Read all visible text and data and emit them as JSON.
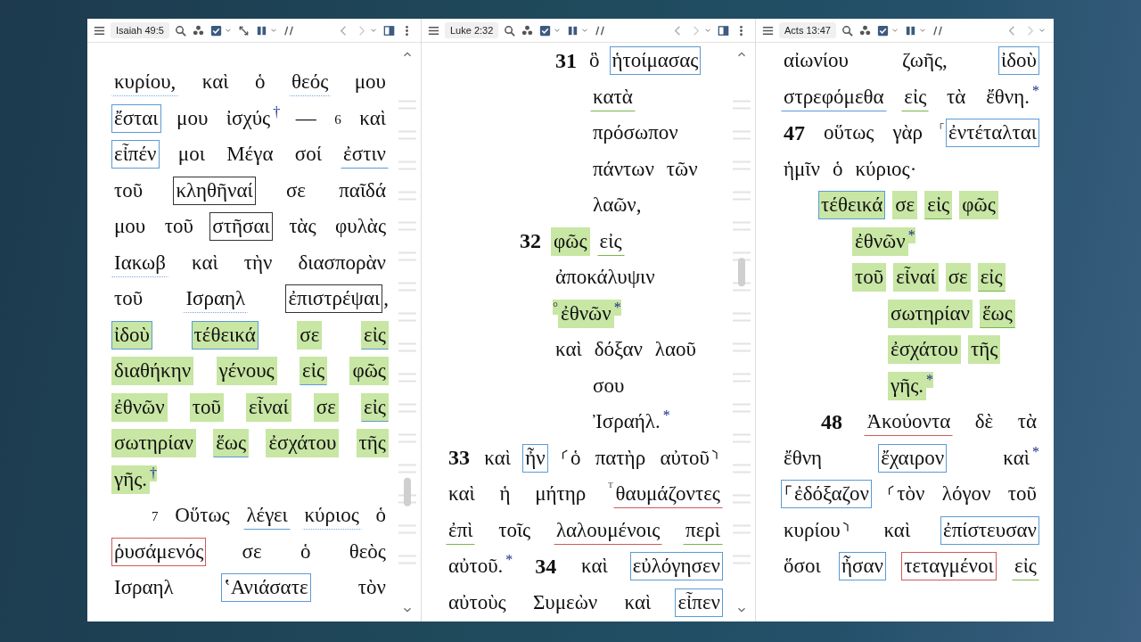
{
  "panes": [
    {
      "toolbar": {
        "reference": "Isaiah 49:5",
        "unlinked": true,
        "pane_menu": true
      },
      "scrollbar": true,
      "lines": [
        {
          "kind": "prose",
          "segs": [
            {
              "t": "κυρίου,",
              "kind": "dotted",
              "highlighted": false
            },
            {
              "t": "καὶ",
              "kind": "plain",
              "highlighted": false
            },
            {
              "t": "ὁ",
              "kind": "plain",
              "highlighted": false
            },
            {
              "t": "θεός",
              "kind": "dotted",
              "highlighted": false
            },
            {
              "t": "μου",
              "kind": "plain",
              "highlighted": false
            }
          ]
        },
        {
          "kind": "prose",
          "segs": [
            {
              "t": "ἔσται",
              "kind": "box",
              "color": "#5b9bd5",
              "highlighted": false
            },
            {
              "t": "μου",
              "kind": "plain",
              "highlighted": false
            },
            {
              "t": "ἰσχύς",
              "kind": "plain",
              "highlighted": false,
              "note": "†"
            },
            {
              "t": "—",
              "kind": "plain",
              "highlighted": false
            },
            {
              "t": "6",
              "kind": "sup",
              "highlighted": false
            },
            {
              "t": "καὶ",
              "kind": "plain",
              "highlighted": false
            }
          ]
        },
        {
          "kind": "prose",
          "segs": [
            {
              "t": "εἶπέν",
              "kind": "box",
              "color": "#5b9bd5",
              "highlighted": false
            },
            {
              "t": "μοι",
              "kind": "plain",
              "highlighted": false
            },
            {
              "t": "Μέγα",
              "kind": "plain",
              "highlighted": false
            },
            {
              "t": "σοί",
              "kind": "plain",
              "highlighted": false
            },
            {
              "t": "ἐστιν",
              "kind": "under",
              "color": "#5b9bd5",
              "highlighted": false
            }
          ]
        },
        {
          "kind": "prose",
          "segs": [
            {
              "t": "τοῦ",
              "kind": "plain",
              "highlighted": false
            },
            {
              "t": "κληθῆναί",
              "kind": "box",
              "color": "#333333",
              "highlighted": false
            },
            {
              "t": "σε",
              "kind": "plain",
              "highlighted": false
            },
            {
              "t": "παῖδά",
              "kind": "plain",
              "highlighted": false
            }
          ]
        },
        {
          "kind": "prose",
          "segs": [
            {
              "t": "μου",
              "kind": "plain",
              "highlighted": false
            },
            {
              "t": "τοῦ",
              "kind": "plain",
              "highlighted": false
            },
            {
              "t": "στῆσαι",
              "kind": "box",
              "color": "#333333",
              "highlighted": false
            },
            {
              "t": "τὰς",
              "kind": "plain",
              "highlighted": false
            },
            {
              "t": "φυλὰς",
              "kind": "plain",
              "highlighted": false
            }
          ]
        },
        {
          "kind": "prose",
          "segs": [
            {
              "t": "Ιακωβ",
              "kind": "dotted",
              "highlighted": false
            },
            {
              "t": "καὶ",
              "kind": "plain",
              "highlighted": false
            },
            {
              "t": "τὴν",
              "kind": "plain",
              "highlighted": false
            },
            {
              "t": "διασπορὰν",
              "kind": "plain",
              "highlighted": false
            }
          ]
        },
        {
          "kind": "prose",
          "segs": [
            {
              "t": "τοῦ",
              "kind": "plain",
              "highlighted": false
            },
            {
              "t": "Ισραηλ",
              "kind": "dotted",
              "highlighted": false
            },
            {
              "t": "ἐπιστρέψαι",
              "kind": "box",
              "color": "#333333",
              "highlighted": false,
              "tail": ","
            }
          ]
        },
        {
          "kind": "prose",
          "segs": [
            {
              "t": "ἰδοὺ",
              "kind": "box",
              "color": "#5b9bd5",
              "highlighted": true
            },
            {
              "t": "τέθεικά",
              "kind": "box",
              "color": "#5b9bd5",
              "highlighted": true
            },
            {
              "t": "σε",
              "kind": "plain",
              "highlighted": true
            },
            {
              "t": "εἰς",
              "kind": "under",
              "color": "#5b9bd5",
              "highlighted": true
            }
          ]
        },
        {
          "kind": "prose",
          "segs": [
            {
              "t": "διαθήκην",
              "kind": "plain",
              "highlighted": true
            },
            {
              "t": "γένους",
              "kind": "plain",
              "highlighted": true
            },
            {
              "t": "εἰς",
              "kind": "under",
              "color": "#5b9bd5",
              "highlighted": true
            },
            {
              "t": "φῶς",
              "kind": "plain",
              "highlighted": true
            }
          ]
        },
        {
          "kind": "prose",
          "segs": [
            {
              "t": "ἐθνῶν",
              "kind": "plain",
              "highlighted": true
            },
            {
              "t": "τοῦ",
              "kind": "plain",
              "highlighted": true
            },
            {
              "t": "εἶναί",
              "kind": "plain",
              "highlighted": true
            },
            {
              "t": "σε",
              "kind": "plain",
              "highlighted": true
            },
            {
              "t": "εἰς",
              "kind": "under",
              "color": "#5b9bd5",
              "highlighted": true
            }
          ]
        },
        {
          "kind": "prose",
          "segs": [
            {
              "t": "σωτηρίαν",
              "kind": "plain",
              "highlighted": true
            },
            {
              "t": "ἕως",
              "kind": "under",
              "color": "#5b9bd5",
              "highlighted": true
            },
            {
              "t": "ἐσχάτου",
              "kind": "plain",
              "highlighted": true
            },
            {
              "t": "τῆς",
              "kind": "plain",
              "highlighted": true
            }
          ]
        },
        {
          "kind": "left",
          "segs": [
            {
              "t": "γῆς.",
              "kind": "plain",
              "highlighted": true,
              "note": "†"
            }
          ]
        },
        {
          "kind": "prose-indent",
          "segs": [
            {
              "t": "7",
              "kind": "sup",
              "highlighted": false
            },
            {
              "t": "Οὕτως",
              "kind": "plain",
              "highlighted": false
            },
            {
              "t": "λέγει",
              "kind": "under",
              "color": "#5b9bd5",
              "highlighted": false
            },
            {
              "t": "κύριος",
              "kind": "dotted",
              "highlighted": false
            },
            {
              "t": "ὁ",
              "kind": "plain",
              "highlighted": false
            }
          ]
        },
        {
          "kind": "prose",
          "segs": [
            {
              "t": "ῥυσάμενός",
              "kind": "box",
              "color": "#d05a5a",
              "highlighted": false
            },
            {
              "t": "σε",
              "kind": "plain",
              "highlighted": false
            },
            {
              "t": "ὁ",
              "kind": "plain",
              "highlighted": false
            },
            {
              "t": "θεὸς",
              "kind": "plain",
              "highlighted": false
            }
          ]
        },
        {
          "kind": "prose",
          "segs": [
            {
              "t": "Ισραηλ",
              "kind": "plain",
              "highlighted": false
            },
            {
              "t": "ʽΑνιάσατε",
              "kind": "box",
              "color": "#5b9bd5",
              "highlighted": false
            },
            {
              "t": "τὸν",
              "kind": "plain",
              "highlighted": false
            }
          ]
        }
      ]
    },
    {
      "toolbar": {
        "reference": "Luke 2:32",
        "unlinked": false,
        "pane_menu": true
      },
      "scrollbar": true,
      "lines": [
        {
          "kind": "indent3",
          "segs": [
            {
              "t": "31",
              "kind": "verse",
              "highlighted": false
            },
            {
              "t": "ὃ",
              "kind": "plain",
              "highlighted": false
            },
            {
              "t": "ἡτοίμασας",
              "kind": "box",
              "color": "#5b9bd5",
              "highlighted": false
            }
          ]
        },
        {
          "kind": "indent4",
          "segs": [
            {
              "t": "κατὰ",
              "kind": "under",
              "color": "#7ab648",
              "highlighted": false
            }
          ]
        },
        {
          "kind": "indent4",
          "segs": [
            {
              "t": "πρόσωπον",
              "kind": "plain",
              "highlighted": false
            }
          ]
        },
        {
          "kind": "indent4",
          "segs": [
            {
              "t": "πάντων",
              "kind": "plain",
              "highlighted": false
            },
            {
              "t": "τῶν",
              "kind": "plain",
              "highlighted": false
            }
          ]
        },
        {
          "kind": "indent4",
          "segs": [
            {
              "t": "λαῶν,",
              "kind": "plain",
              "highlighted": false
            }
          ]
        },
        {
          "kind": "indent2",
          "segs": [
            {
              "t": "32",
              "kind": "verse",
              "highlighted": false
            },
            {
              "t": "φῶς",
              "kind": "plain",
              "highlighted": true
            },
            {
              "t": "εἰς",
              "kind": "under",
              "color": "#7ab648",
              "highlighted": false
            }
          ]
        },
        {
          "kind": "indent3",
          "segs": [
            {
              "t": "ἀποκάλυψιν",
              "kind": "plain",
              "highlighted": false
            }
          ]
        },
        {
          "kind": "indent3",
          "segs": [
            {
              "t": "ἐθνῶν",
              "kind": "plain",
              "highlighted": true,
              "pre": "°",
              "note": "*"
            }
          ]
        },
        {
          "kind": "indent3",
          "segs": [
            {
              "t": "καὶ",
              "kind": "plain",
              "highlighted": false
            },
            {
              "t": "δόξαν",
              "kind": "plain",
              "highlighted": false
            },
            {
              "t": "λαοῦ",
              "kind": "plain",
              "highlighted": false
            }
          ]
        },
        {
          "kind": "indent4",
          "segs": [
            {
              "t": "σου",
              "kind": "plain",
              "highlighted": false
            }
          ]
        },
        {
          "kind": "indent4",
          "segs": [
            {
              "t": "Ἰσραήλ.",
              "kind": "plain",
              "highlighted": false,
              "note": "*"
            }
          ]
        },
        {
          "kind": "prose",
          "segs": [
            {
              "t": "33",
              "kind": "verse",
              "highlighted": false
            },
            {
              "t": "καὶ",
              "kind": "plain",
              "highlighted": false
            },
            {
              "t": "ἦν",
              "kind": "box",
              "color": "#5b9bd5",
              "highlighted": false
            },
            {
              "t": "⸂ὁ",
              "kind": "plain",
              "highlighted": false
            },
            {
              "t": "πατὴρ",
              "kind": "plain",
              "highlighted": false
            },
            {
              "t": "αὐτοῦ⸃",
              "kind": "plain",
              "highlighted": false
            }
          ]
        },
        {
          "kind": "prose",
          "segs": [
            {
              "t": "καὶ",
              "kind": "plain",
              "highlighted": false
            },
            {
              "t": "ἡ",
              "kind": "plain",
              "highlighted": false
            },
            {
              "t": "μήτηρ",
              "kind": "plain",
              "highlighted": false
            },
            {
              "t": "θαυμάζοντες",
              "kind": "under",
              "color": "#d05a5a",
              "highlighted": false,
              "pre": "ᵀ"
            }
          ]
        },
        {
          "kind": "prose",
          "segs": [
            {
              "t": "ἐπὶ",
              "kind": "under",
              "color": "#7ab648",
              "highlighted": false
            },
            {
              "t": "τοῖς",
              "kind": "plain",
              "highlighted": false
            },
            {
              "t": "λαλουμένοις",
              "kind": "under",
              "color": "#d05a5a",
              "highlighted": false
            },
            {
              "t": "περὶ",
              "kind": "under",
              "color": "#7ab648",
              "highlighted": false
            }
          ]
        },
        {
          "kind": "prose",
          "segs": [
            {
              "t": "αὐτοῦ.",
              "kind": "plain",
              "highlighted": false,
              "note": "*"
            },
            {
              "t": "34",
              "kind": "verse",
              "highlighted": false
            },
            {
              "t": "καὶ",
              "kind": "plain",
              "highlighted": false
            },
            {
              "t": "εὐλόγησεν",
              "kind": "box",
              "color": "#5b9bd5",
              "highlighted": false
            }
          ]
        },
        {
          "kind": "prose",
          "segs": [
            {
              "t": "αὐτοὺς",
              "kind": "plain",
              "highlighted": false
            },
            {
              "t": "Συμεὼν",
              "kind": "plain",
              "highlighted": false
            },
            {
              "t": "καὶ",
              "kind": "plain",
              "highlighted": false
            },
            {
              "t": "εἶπεν",
              "kind": "box",
              "color": "#5b9bd5",
              "highlighted": false
            }
          ]
        }
      ]
    },
    {
      "toolbar": {
        "reference": "Acts 13:47",
        "unlinked": false,
        "pane_menu": false
      },
      "scrollbar": false,
      "lines": [
        {
          "kind": "prose",
          "segs": [
            {
              "t": "αἰωνίου",
              "kind": "plain",
              "highlighted": false
            },
            {
              "t": "ζωῆς,",
              "kind": "plain",
              "highlighted": false
            },
            {
              "t": "ἰδοὺ",
              "kind": "box",
              "color": "#5b9bd5",
              "highlighted": false
            }
          ]
        },
        {
          "kind": "prose",
          "segs": [
            {
              "t": "στρεφόμεθα",
              "kind": "under",
              "color": "#5b9bd5",
              "highlighted": false
            },
            {
              "t": "εἰς",
              "kind": "under",
              "color": "#7ab648",
              "highlighted": false
            },
            {
              "t": "τὰ",
              "kind": "plain",
              "highlighted": false
            },
            {
              "t": "ἔθνη.",
              "kind": "plain",
              "highlighted": false,
              "note": "*"
            }
          ]
        },
        {
          "kind": "prose",
          "segs": [
            {
              "t": "47",
              "kind": "verse",
              "highlighted": false
            },
            {
              "t": "οὕτως",
              "kind": "plain",
              "highlighted": false
            },
            {
              "t": "γὰρ",
              "kind": "plain",
              "highlighted": false
            },
            {
              "t": "ἐντέταλται",
              "kind": "box",
              "color": "#5b9bd5",
              "highlighted": false,
              "pre": "⸀"
            }
          ]
        },
        {
          "kind": "left",
          "segs": [
            {
              "t": "ἡμῖν",
              "kind": "plain",
              "highlighted": false
            },
            {
              "t": "ὁ",
              "kind": "plain",
              "highlighted": false
            },
            {
              "t": "κύριος·",
              "kind": "plain",
              "highlighted": false
            }
          ]
        },
        {
          "kind": "indent1",
          "segs": [
            {
              "t": "τέθεικά",
              "kind": "box",
              "color": "#5b9bd5",
              "highlighted": true
            },
            {
              "t": "σε",
              "kind": "plain",
              "highlighted": true
            },
            {
              "t": "εἰς",
              "kind": "under",
              "color": "#7ab648",
              "highlighted": true
            },
            {
              "t": "φῶς",
              "kind": "plain",
              "highlighted": true
            }
          ]
        },
        {
          "kind": "indent2",
          "segs": [
            {
              "t": "ἐθνῶν",
              "kind": "plain",
              "highlighted": true,
              "note": "*"
            }
          ]
        },
        {
          "kind": "indent2",
          "segs": [
            {
              "t": "τοῦ",
              "kind": "plain",
              "highlighted": true
            },
            {
              "t": "εἶναί",
              "kind": "plain",
              "highlighted": true
            },
            {
              "t": "σε",
              "kind": "plain",
              "highlighted": true
            },
            {
              "t": "εἰς",
              "kind": "under",
              "color": "#7ab648",
              "highlighted": true
            }
          ]
        },
        {
          "kind": "indent3",
          "segs": [
            {
              "t": "σωτηρίαν",
              "kind": "plain",
              "highlighted": true
            },
            {
              "t": "ἕως",
              "kind": "under",
              "color": "#7ab648",
              "highlighted": true
            }
          ]
        },
        {
          "kind": "indent3",
          "segs": [
            {
              "t": "ἐσχάτου",
              "kind": "plain",
              "highlighted": true
            },
            {
              "t": "τῆς",
              "kind": "plain",
              "highlighted": true
            }
          ]
        },
        {
          "kind": "indent3",
          "segs": [
            {
              "t": "γῆς.",
              "kind": "plain",
              "highlighted": true,
              "note": "*"
            }
          ]
        },
        {
          "kind": "prose-indent",
          "segs": [
            {
              "t": "48",
              "kind": "verse",
              "highlighted": false
            },
            {
              "t": "Ἀκούοντα",
              "kind": "under",
              "color": "#d05a5a",
              "highlighted": false
            },
            {
              "t": "δὲ",
              "kind": "plain",
              "highlighted": false
            },
            {
              "t": "τὰ",
              "kind": "plain",
              "highlighted": false
            }
          ]
        },
        {
          "kind": "prose",
          "segs": [
            {
              "t": "ἔθνη",
              "kind": "plain",
              "highlighted": false
            },
            {
              "t": "ἔχαιρον",
              "kind": "box",
              "color": "#5b9bd5",
              "highlighted": false
            },
            {
              "t": "καὶ",
              "kind": "plain",
              "highlighted": false,
              "note": "*"
            }
          ]
        },
        {
          "kind": "prose",
          "segs": [
            {
              "t": "⸀ἐδόξαζον",
              "kind": "box",
              "color": "#5b9bd5",
              "highlighted": false
            },
            {
              "t": "⸂τὸν",
              "kind": "plain",
              "highlighted": false
            },
            {
              "t": "λόγον",
              "kind": "plain",
              "highlighted": false
            },
            {
              "t": "τοῦ",
              "kind": "plain",
              "highlighted": false
            }
          ]
        },
        {
          "kind": "prose",
          "segs": [
            {
              "t": "κυρίου⸃",
              "kind": "plain",
              "highlighted": false
            },
            {
              "t": "καὶ",
              "kind": "plain",
              "highlighted": false
            },
            {
              "t": "ἐπίστευσαν",
              "kind": "box",
              "color": "#5b9bd5",
              "highlighted": false
            }
          ]
        },
        {
          "kind": "prose",
          "segs": [
            {
              "t": "ὅσοι",
              "kind": "plain",
              "highlighted": false
            },
            {
              "t": "ἦσαν",
              "kind": "box",
              "color": "#5b9bd5",
              "highlighted": false
            },
            {
              "t": "τεταγμένοι",
              "kind": "box",
              "color": "#d05a5a",
              "highlighted": false
            },
            {
              "t": "εἰς",
              "kind": "under",
              "color": "#7ab648",
              "highlighted": false
            }
          ]
        }
      ]
    }
  ]
}
